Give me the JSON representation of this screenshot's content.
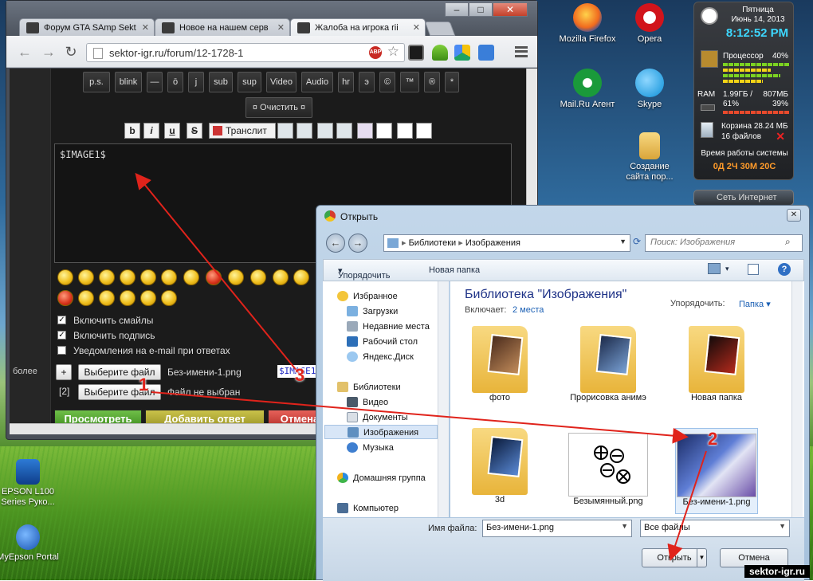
{
  "browser": {
    "tabs": [
      {
        "title": "Форум GTA SAmp Sekt"
      },
      {
        "title": "Новое на нашем серв"
      },
      {
        "title": "Жалоба на игрока rii"
      }
    ],
    "url": "sektor-igr.ru/forum/12-1728-1",
    "abp_label": "ABP"
  },
  "forum": {
    "format_buttons": [
      "p.s.",
      "blink",
      "—",
      "ō",
      "j",
      "sub",
      "sup",
      "Video",
      "Audio",
      "hr",
      "э",
      "©",
      "™",
      "®",
      "*"
    ],
    "clear_button": "¤ Очистить ¤",
    "style_buttons": [
      "b",
      "i",
      "u",
      "S"
    ],
    "translit": "Транслит",
    "editor_text": "$IMAGE1$",
    "checkboxes": [
      {
        "label": "Включить смайлы",
        "checked": true
      },
      {
        "label": "Включить подпись",
        "checked": true
      },
      {
        "label": "Уведомления на e-mail при ответах",
        "checked": false
      }
    ],
    "side_label": "более",
    "add_button": "+",
    "row2_label": "[2]",
    "choose_file_label": "Выберите файл",
    "file1_name": "Без-имени-1.png",
    "file2_name": "Файл не выбран",
    "image_token": "$IMAGE1$",
    "actions": [
      "Просмотреть",
      "Добавить ответ",
      "Отмена"
    ]
  },
  "desktop": {
    "icons": [
      {
        "label": "Mozilla Firefox"
      },
      {
        "label": "Opera"
      },
      {
        "label": "Mail.Ru Агент"
      },
      {
        "label": "Skype"
      },
      {
        "label": "Создание сайта пор..."
      },
      {
        "label": "EPSON L100 Series Руко..."
      },
      {
        "label": "MyEpson Portal"
      }
    ]
  },
  "gadget": {
    "day": "Пятница",
    "date": "Июнь 14, 2013",
    "time": "8:12:52 PM",
    "cpu_label": "Процессор",
    "cpu_percent": "40%",
    "cpu_level": 0.4,
    "ram_label": "RAM",
    "ram_used": "1.99ГБ /",
    "ram_total": "807МБ",
    "ram_percent1": "61%",
    "ram_percent2": "39%",
    "ram_level": 0.61,
    "bin": "Корзина 28.24 МБ",
    "bin_files": "16 файлов",
    "uptime_label": "Время работы системы",
    "uptime": "0Д 2Ч 30М 20С",
    "network": "Сеть Интернет"
  },
  "dialog": {
    "title": "Открыть",
    "breadcrumb": [
      "Библиотеки",
      "Изображения"
    ],
    "search_placeholder": "Поиск: Изображения",
    "organize": "Упорядочить",
    "new_folder": "Новая папка",
    "nav": {
      "favorites": "Избранное",
      "downloads": "Загрузки",
      "recent": "Недавние места",
      "desktop": "Рабочий стол",
      "yadisk": "Яндекс.Диск",
      "libraries": "Библиотеки",
      "video": "Видео",
      "documents": "Документы",
      "images": "Изображения",
      "music": "Музыка",
      "homegroup": "Домашняя группа",
      "computer": "Компьютер"
    },
    "library_title": "Библиотека \"Изображения\"",
    "includes_label": "Включает:",
    "includes_value": "2 места",
    "arrange_label": "Упорядочить:",
    "arrange_value": "Папка",
    "items": [
      "фото",
      "Прорисовка анимэ",
      "Новая папка",
      "3d",
      "Безымянный.png",
      "Без-имени-1.png"
    ],
    "filename_label": "Имя файла:",
    "filename_value": "Без-имени-1.png",
    "filetype": "Все файлы",
    "open_button": "Открыть",
    "cancel_button": "Отмена"
  },
  "annotations": {
    "marks": [
      "1",
      "2",
      "3"
    ],
    "color": "#e0231b"
  },
  "watermark": "sektor-igr.ru"
}
